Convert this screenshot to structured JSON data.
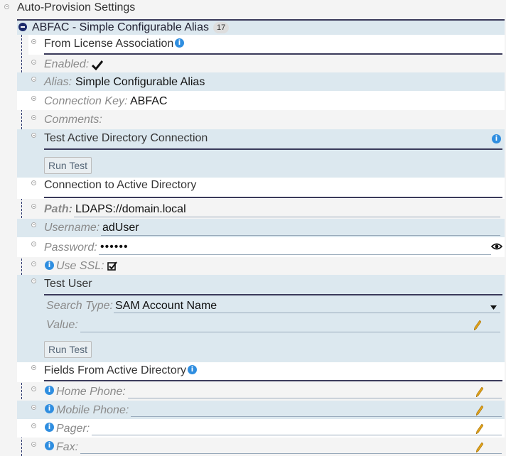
{
  "tree": {
    "root_label": "Auto-Provision Settings",
    "node_title": "ABFAC - Simple Configurable Alias",
    "node_badge": "17"
  },
  "license": {
    "section_title": "From License Association",
    "enabled_label": "Enabled:",
    "alias_label": "Alias:",
    "alias_value": "Simple Configurable Alias",
    "connection_key_label": "Connection Key:",
    "connection_key_value": "ABFAC",
    "comments_label": "Comments:"
  },
  "test_ad": {
    "section_title": "Test Active Directory Connection",
    "run_test_label": "Run Test"
  },
  "connection": {
    "section_title": "Connection to Active Directory",
    "path_label": "Path:",
    "path_value": "LDAPS://domain.local",
    "username_label": "Username:",
    "username_value": "adUser",
    "password_label": "Password:",
    "password_value": "••••••",
    "use_ssl_label": "Use SSL:"
  },
  "test_user": {
    "section_title": "Test User",
    "search_type_label": "Search Type:",
    "search_type_value": "SAM Account Name",
    "value_label": "Value:",
    "value_value": "",
    "run_test_label": "Run Test"
  },
  "fields": {
    "section_title": "Fields From Active Directory",
    "home_phone_label": "Home Phone:",
    "mobile_phone_label": "Mobile Phone:",
    "pager_label": "Pager:",
    "fax_label": "Fax:"
  },
  "colors": {
    "accent": "#1b2a6b",
    "info": "#2f8ee0",
    "band_blue": "#dce8ef",
    "pencil": "#e0a21a"
  },
  "icons": [
    "collapse-icon",
    "info-icon",
    "check-icon",
    "checkbox-checked-icon",
    "eye-icon",
    "pencil-icon",
    "dropdown-arrow-icon"
  ]
}
